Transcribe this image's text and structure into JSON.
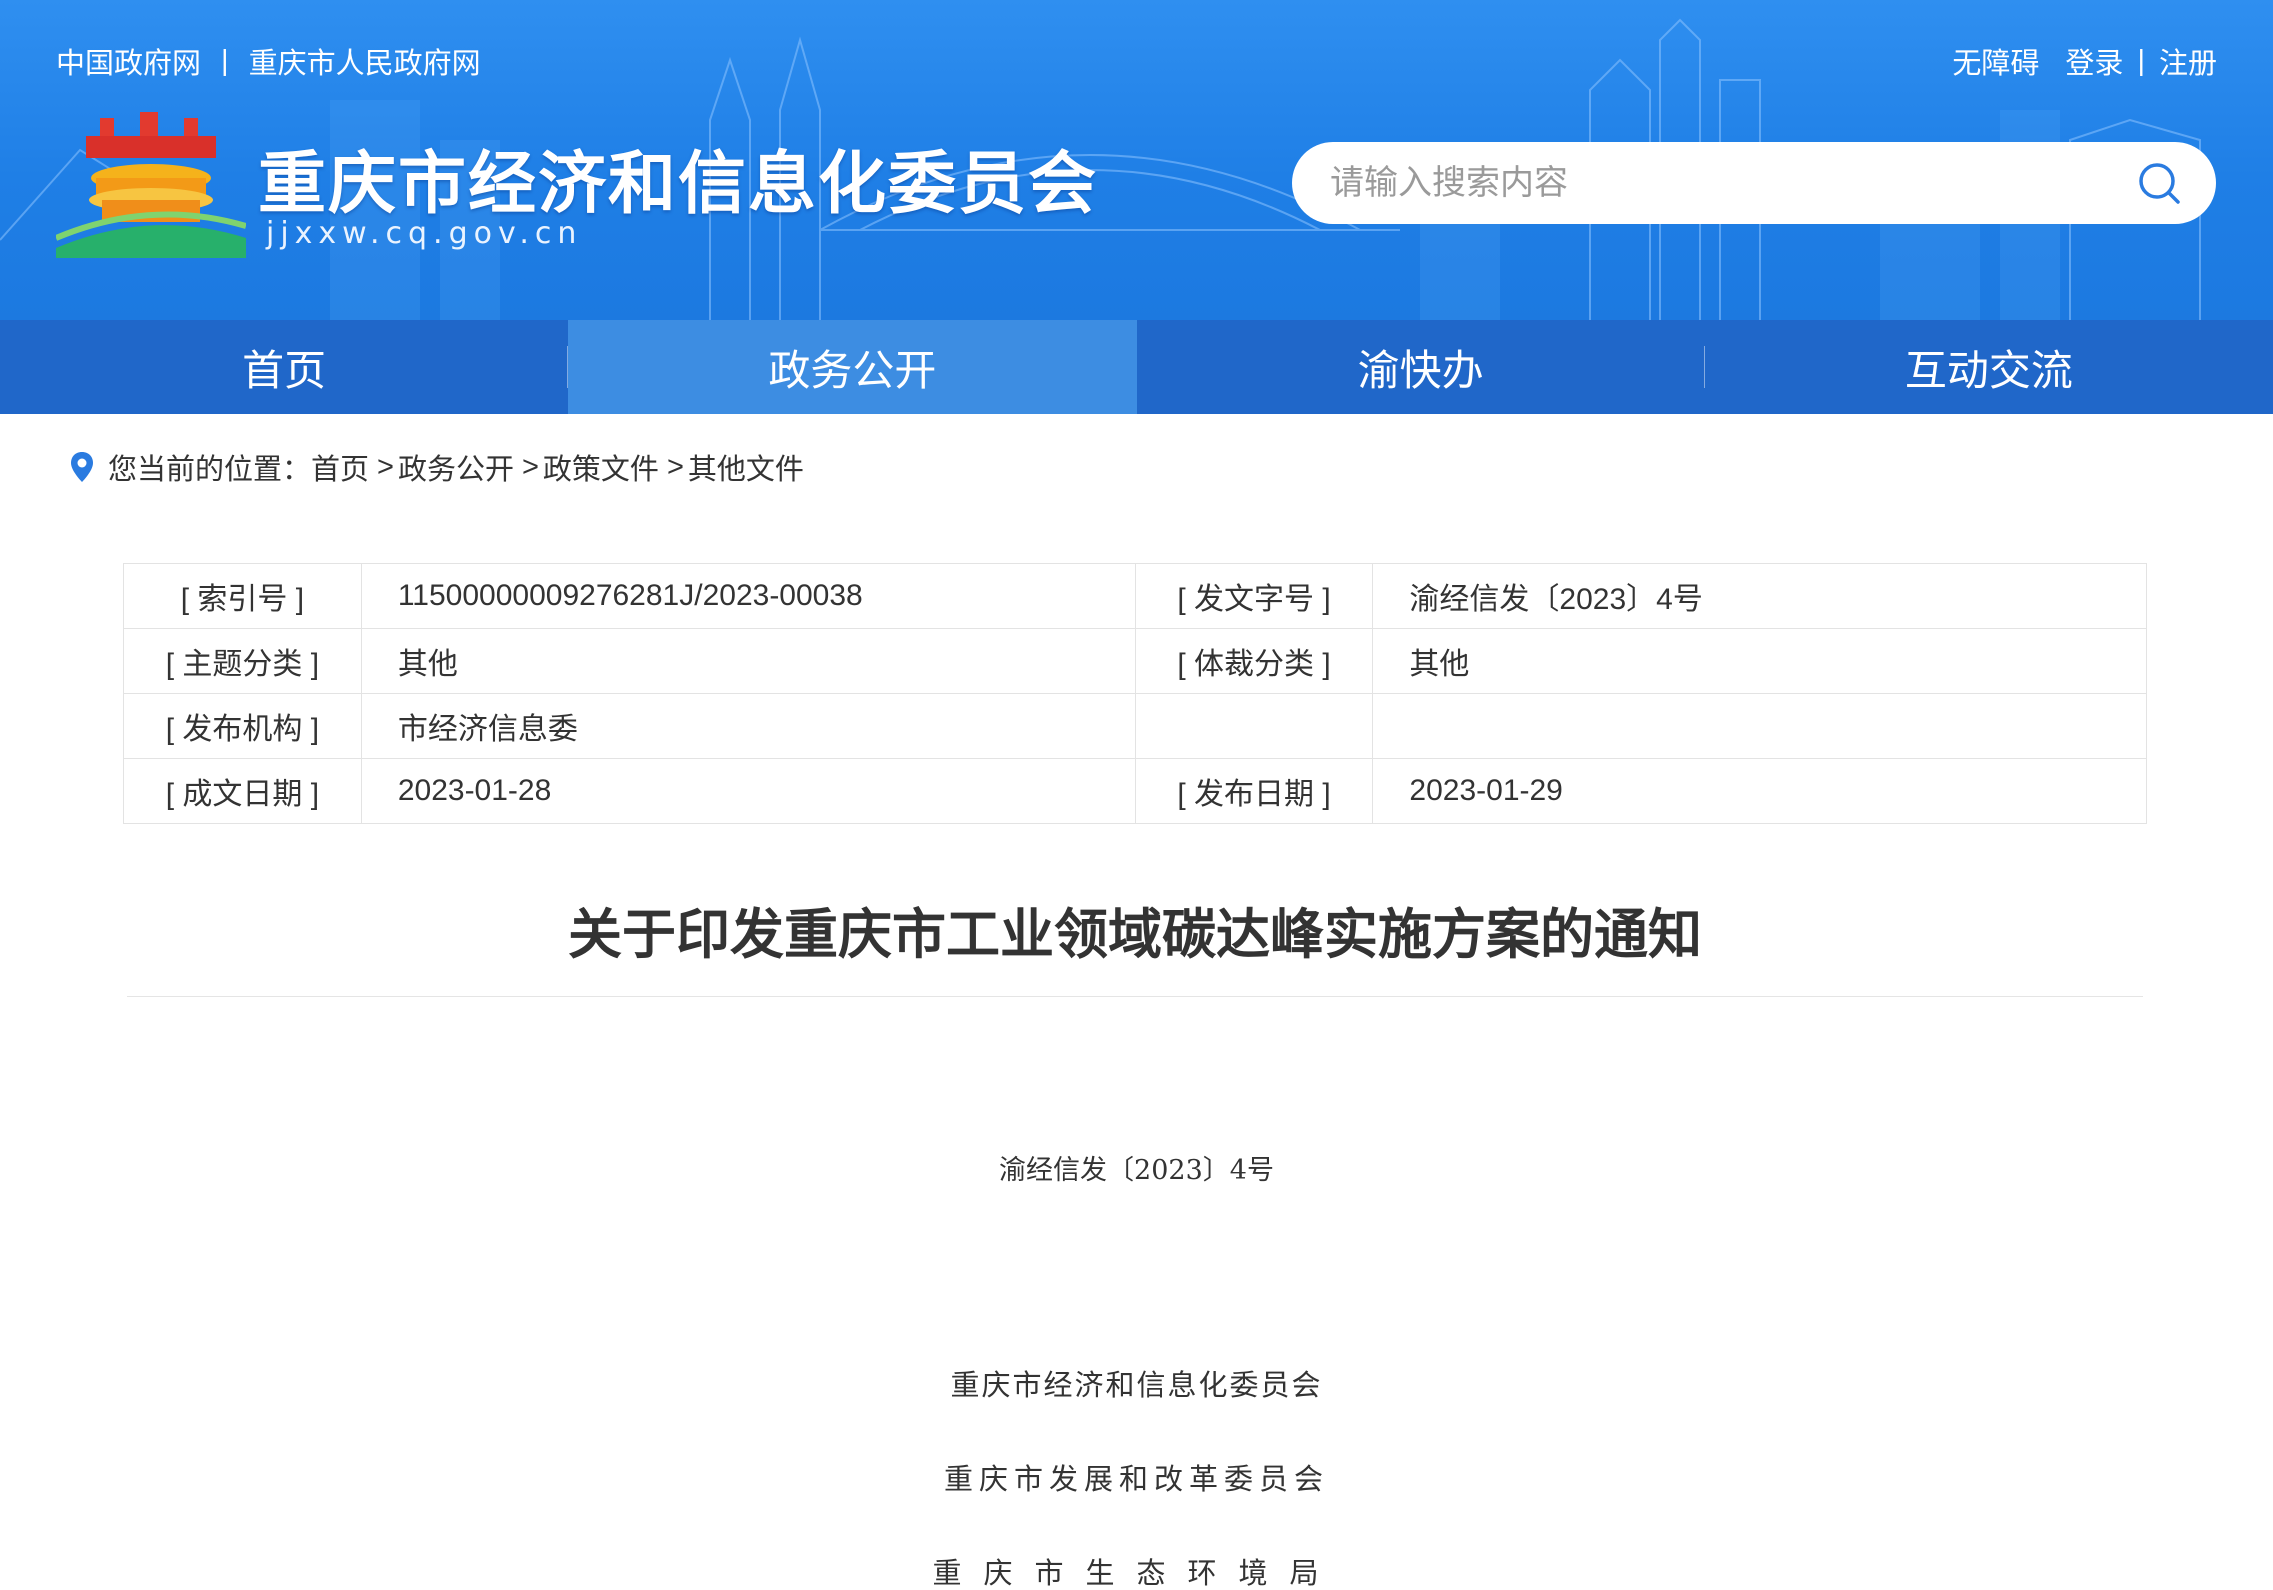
{
  "header": {
    "top_links": [
      "中国政府网",
      "重庆市人民政府网"
    ],
    "top_right": {
      "accessibility": "无障碍",
      "login": "登录",
      "register": "注册"
    },
    "site_title": "重庆市经济和信息化委员会",
    "site_domain": "jjxxw.cq.gov.cn",
    "search_placeholder": "请输入搜索内容",
    "separator": "|"
  },
  "nav": {
    "items": [
      {
        "label": "首页",
        "active": false
      },
      {
        "label": "政务公开",
        "active": true
      },
      {
        "label": "渝快办",
        "active": false
      },
      {
        "label": "互动交流",
        "active": false
      }
    ]
  },
  "breadcrumb": {
    "prefix": "您当前的位置：",
    "items": [
      "首页",
      "政务公开",
      "政策文件",
      "其他文件"
    ],
    "arrow": ">"
  },
  "meta": {
    "rows": [
      {
        "label1": "[ 索引号 ]",
        "value1": "11500000009276281J/2023-00038",
        "label2": "[ 发文字号 ]",
        "value2": "渝经信发〔2023〕4号"
      },
      {
        "label1": "[ 主题分类 ]",
        "value1": "其他",
        "label2": "[ 体裁分类 ]",
        "value2": "其他"
      },
      {
        "label1": "[ 发布机构 ]",
        "value1": "市经济信息委",
        "label2": "",
        "value2": ""
      },
      {
        "label1": "[ 成文日期 ]",
        "value1": "2023-01-28",
        "label2": "[ 发布日期 ]",
        "value2": "2023-01-29"
      }
    ]
  },
  "article": {
    "title": "关于印发重庆市工业领域碳达峰实施方案的通知",
    "doc_number": "渝经信发〔2023〕4号",
    "issuers": [
      "重庆市经济和信息化委员会",
      "重庆市发展和改革委员会",
      "重庆市生态环境局"
    ]
  },
  "colors": {
    "header_blue": "#1f7fe6",
    "nav_blue": "#2067c9",
    "nav_active": "#3d8de2",
    "text": "#333333"
  }
}
